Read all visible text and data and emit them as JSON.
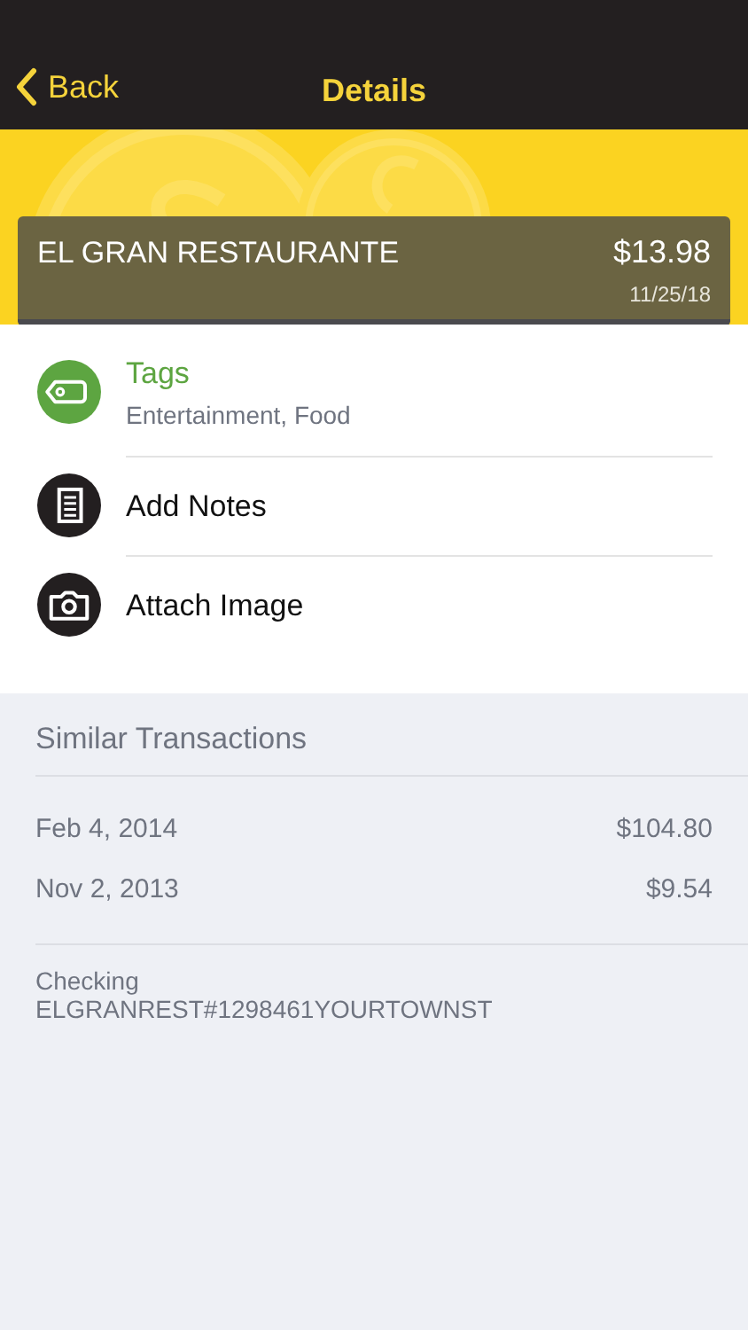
{
  "nav": {
    "back": "Back",
    "title": "Details"
  },
  "transaction": {
    "merchant": "EL GRAN RESTAURANTE",
    "amount": "$13.98",
    "date": "11/25/18"
  },
  "actions": [
    {
      "kind": "tags",
      "title": "Tags",
      "subtitle": "Entertainment, Food",
      "color": "#5da541"
    },
    {
      "kind": "notes",
      "title": "Add Notes",
      "color": "#231f20"
    },
    {
      "kind": "camera",
      "title": "Attach Image",
      "color": "#231f20"
    }
  ],
  "similar": {
    "heading": "Similar Transactions",
    "rows": [
      {
        "date": "Feb 4, 2014",
        "amount": "$104.80"
      },
      {
        "date": "Nov 2, 2013",
        "amount": "$9.54"
      }
    ]
  },
  "account": {
    "name": "Checking",
    "description": "ELGRANREST#1298461YOURTOWNST"
  }
}
